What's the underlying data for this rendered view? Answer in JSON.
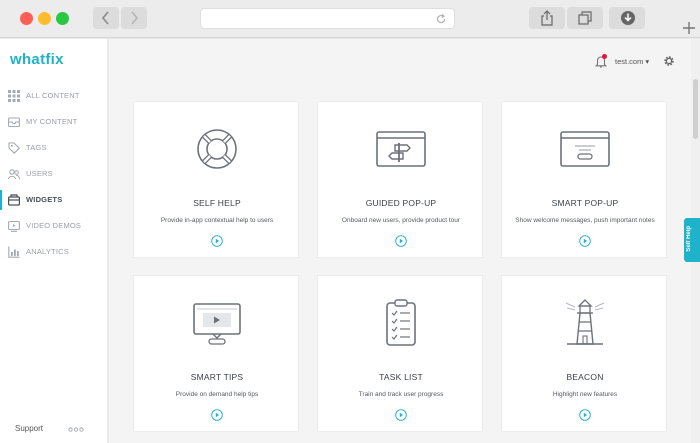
{
  "sidebar": {
    "logo": "whatfix",
    "items": [
      {
        "label": "ALL CONTENT",
        "icon": "grid-icon"
      },
      {
        "label": "MY CONTENT",
        "icon": "inbox-icon"
      },
      {
        "label": "TAGS",
        "icon": "tag-icon"
      },
      {
        "label": "USERS",
        "icon": "users-icon"
      },
      {
        "label": "WIDGETS",
        "icon": "widgets-icon",
        "active": true
      },
      {
        "label": "VIDEO DEMOS",
        "icon": "video-icon"
      },
      {
        "label": "ANALYTICS",
        "icon": "analytics-icon"
      }
    ],
    "support": "Support"
  },
  "header": {
    "account": "test.com ▾"
  },
  "self_help_tab": "Self Help",
  "cards": [
    {
      "title": "SELF HELP",
      "desc": "Provide in-app contextual help to users",
      "icon": "lifebuoy-icon"
    },
    {
      "title": "GUIDED POP-UP",
      "desc": "Onboard new users, provide product tour",
      "icon": "signpost-icon"
    },
    {
      "title": "SMART POP-UP",
      "desc": "Show welcome messages, push important notes",
      "icon": "popup-window-icon"
    },
    {
      "title": "SMART TIPS",
      "desc": "Provide on demand help tips",
      "icon": "monitor-icon"
    },
    {
      "title": "TASK LIST",
      "desc": "Train and track user progress",
      "icon": "clipboard-icon"
    },
    {
      "title": "BEACON",
      "desc": "Highlight new features",
      "icon": "lighthouse-icon"
    }
  ],
  "colors": {
    "accent": "#1fb2cb",
    "notification": "#e8132c"
  }
}
